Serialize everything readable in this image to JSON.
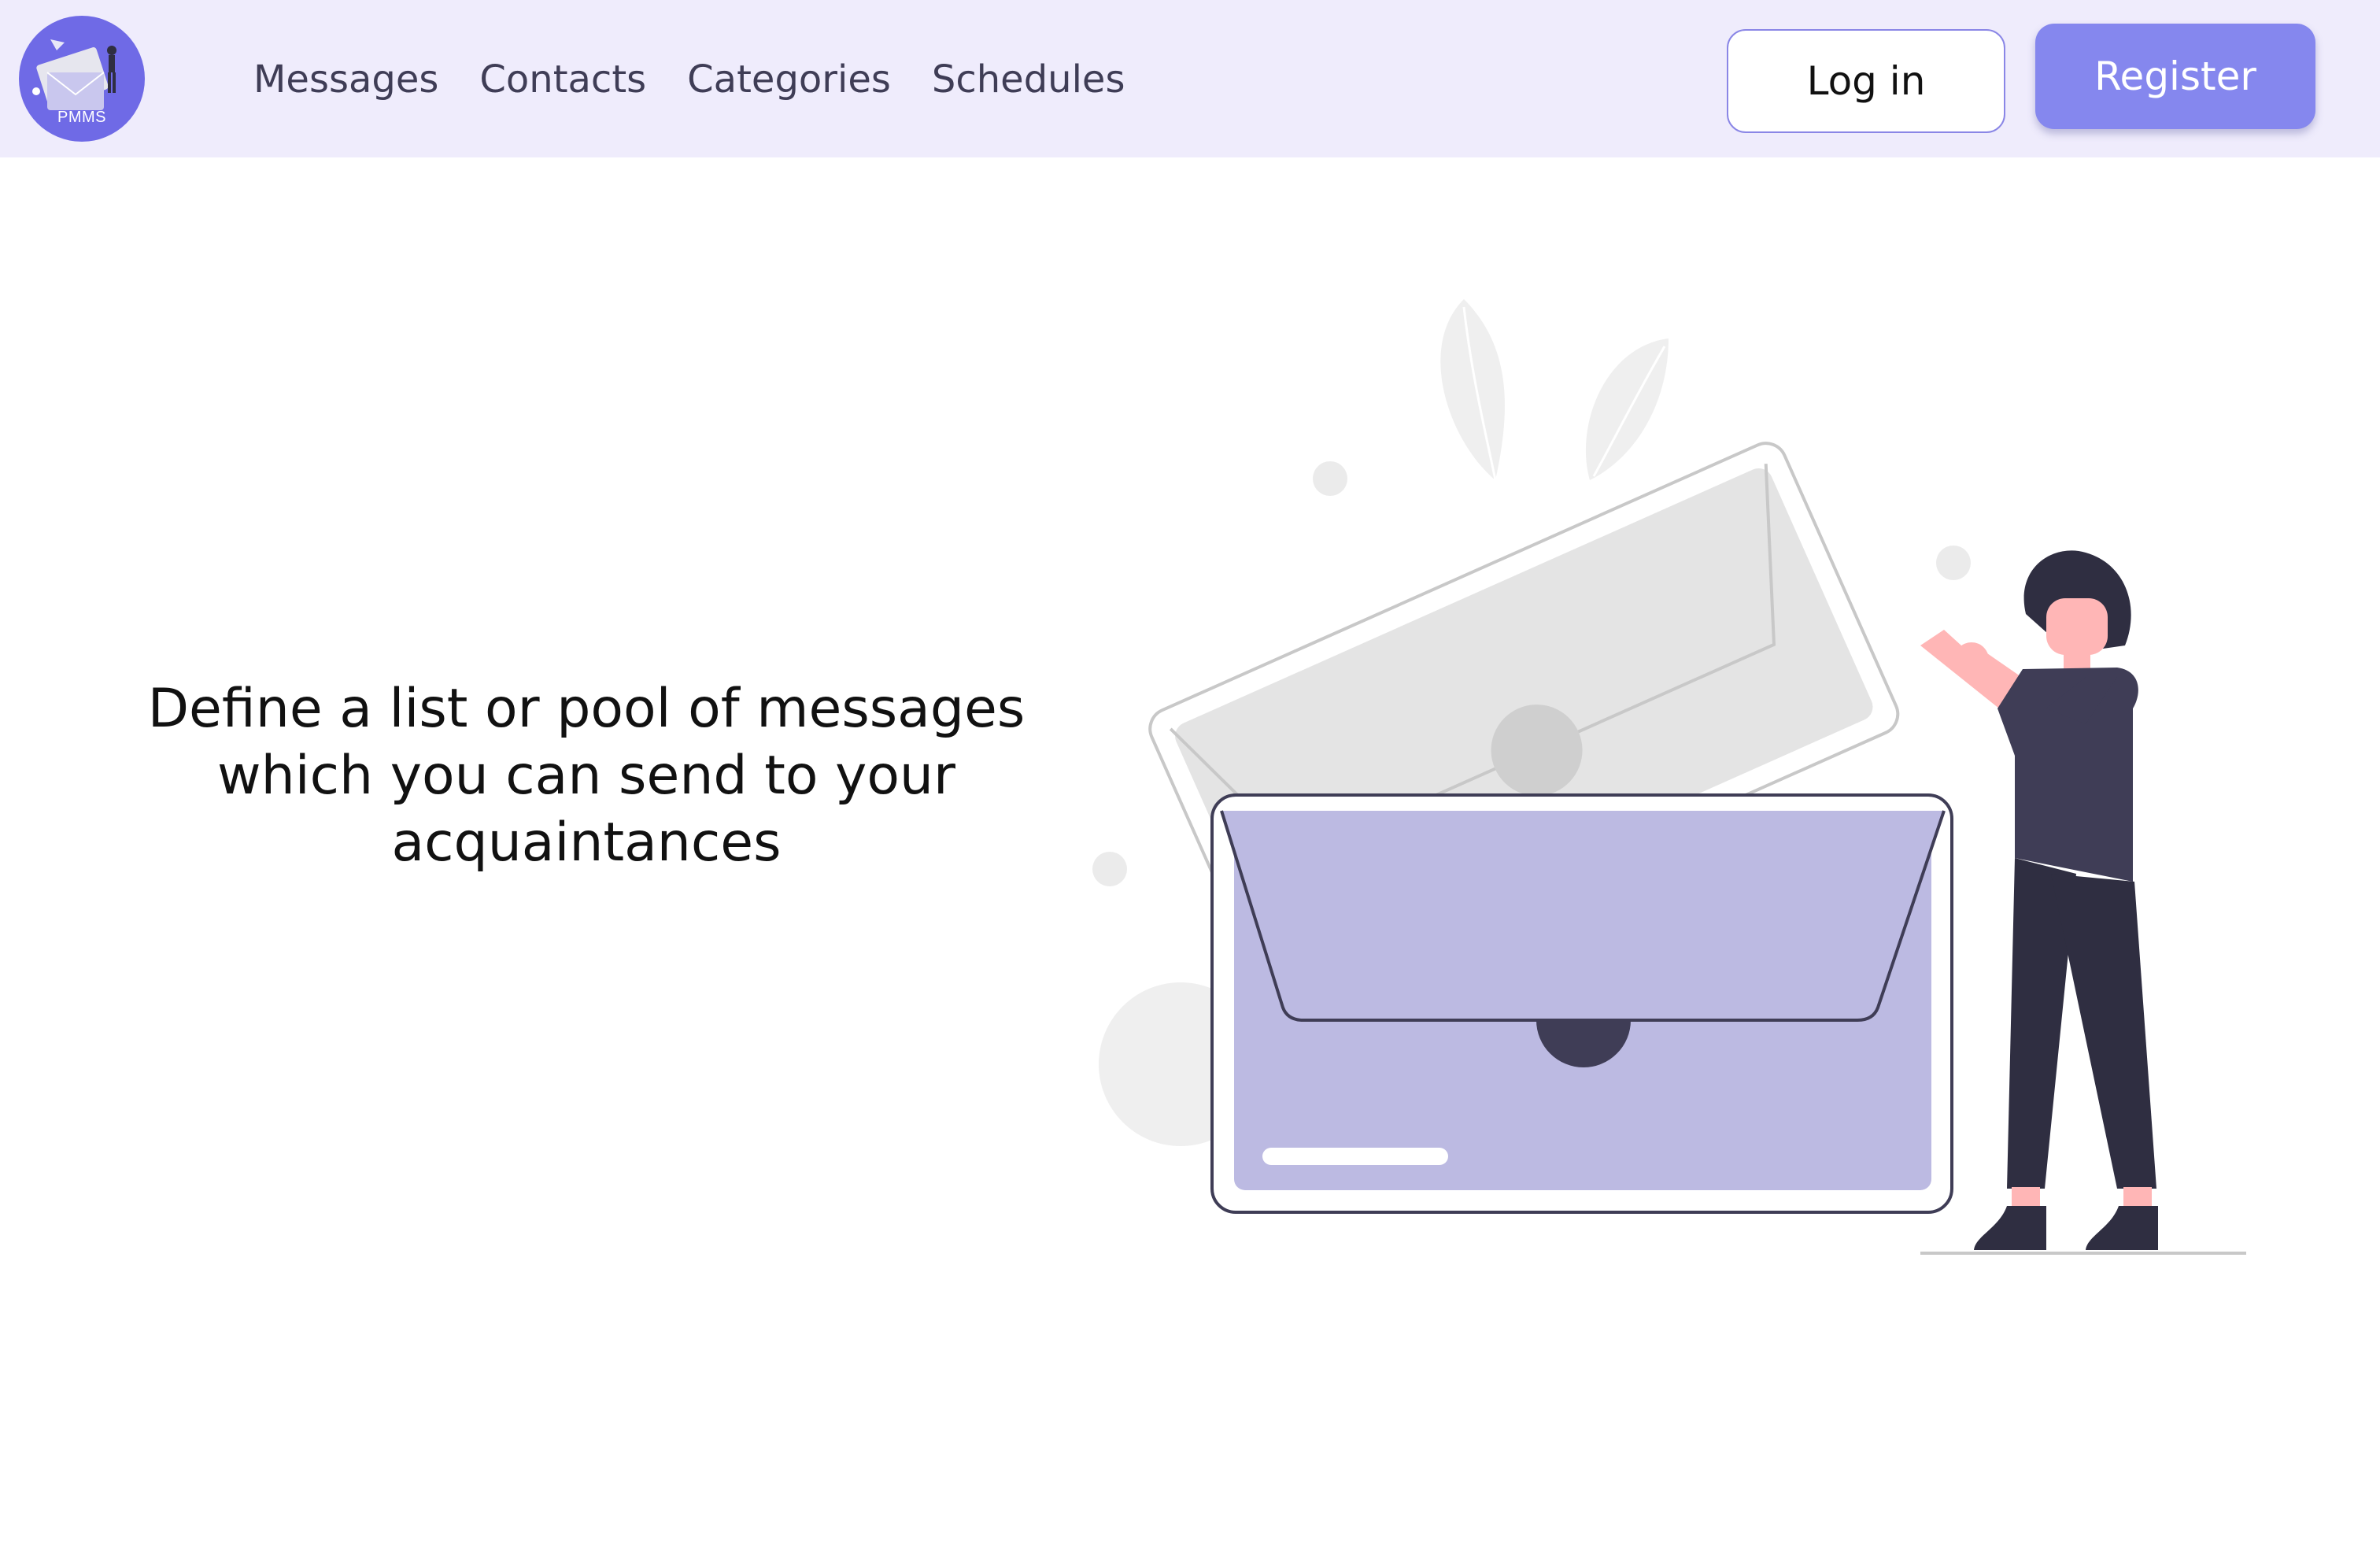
{
  "brand": {
    "logo_text": "PMMS"
  },
  "nav": {
    "items": [
      "Messages",
      "Contacts",
      "Categories",
      "Schedules"
    ]
  },
  "auth": {
    "login_label": "Log in",
    "register_label": "Register"
  },
  "hero": {
    "text": "Define a list or pool of messages which you can send to your acquaintances"
  },
  "colors": {
    "navbar_bg": "#efecfc",
    "accent": "#8587ee",
    "envelope_fill": "#bcbae2",
    "dark": "#3f3d56"
  }
}
